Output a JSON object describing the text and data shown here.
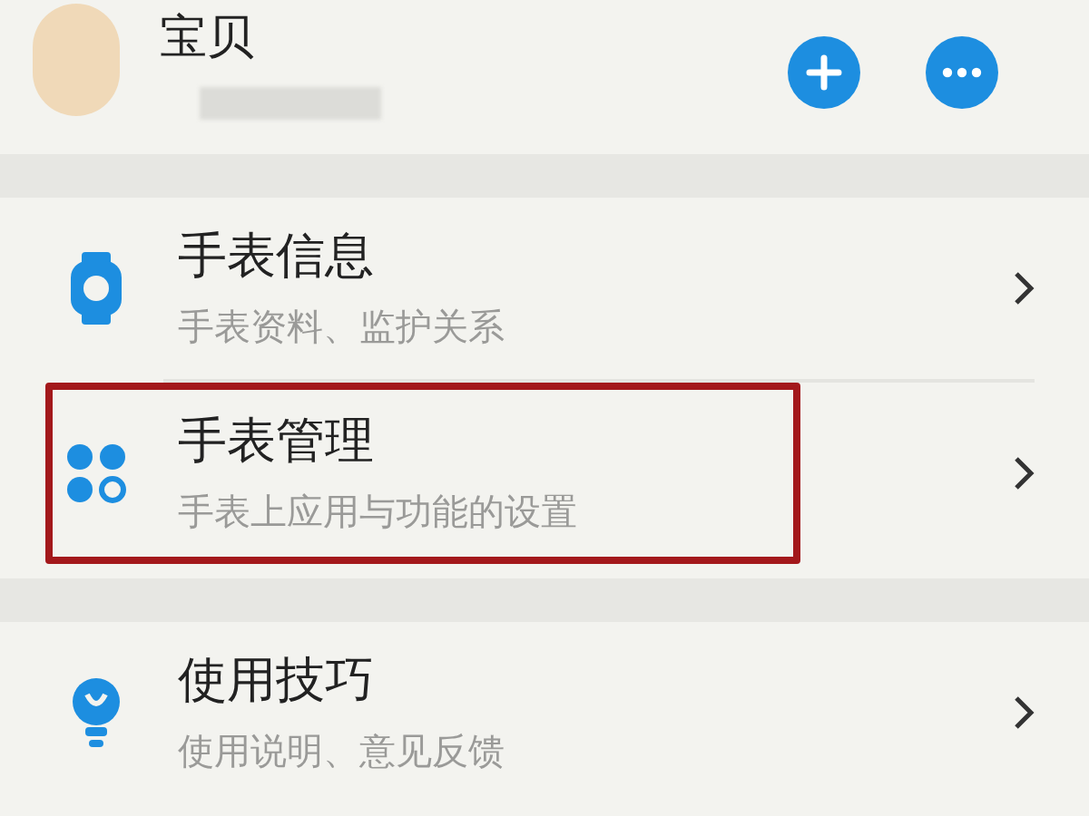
{
  "profile": {
    "name": "宝贝"
  },
  "header_buttons": [
    {
      "kind": "add"
    },
    {
      "kind": "more"
    }
  ],
  "menu_groups": [
    {
      "items": [
        {
          "kind": "watch",
          "title": "手表信息",
          "subtitle": "手表资料、监护关系",
          "highlighted": false
        },
        {
          "kind": "apps",
          "title": "手表管理",
          "subtitle": "手表上应用与功能的设置",
          "highlighted": true
        }
      ]
    },
    {
      "items": [
        {
          "kind": "bulb",
          "title": "使用技巧",
          "subtitle": "使用说明、意见反馈",
          "highlighted": false
        }
      ]
    }
  ]
}
